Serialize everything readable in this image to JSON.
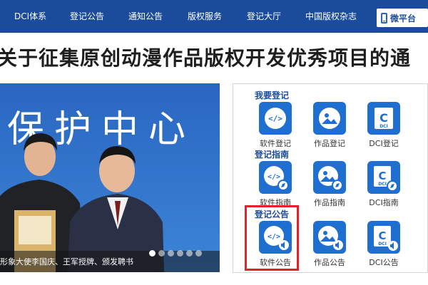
{
  "nav": {
    "items": [
      {
        "label": "DCI体系"
      },
      {
        "label": "登记公告"
      },
      {
        "label": "通知公告"
      },
      {
        "label": "版权服务"
      },
      {
        "label": "登记大厅"
      },
      {
        "label": "中国版权杂志"
      }
    ],
    "mobile_label": "微平台"
  },
  "headline": "关于征集原创动漫作品版权开发优秀项目的通",
  "slideshow": {
    "backdrop_text": "保护中心",
    "caption": "形象大使李国庆、王军授牌、颁发聘书",
    "dot_count": 6,
    "active_dot": 1
  },
  "panel": {
    "sections": [
      {
        "title": "我要登记",
        "tiles": [
          {
            "label": "软件登记",
            "icon": "code-icon"
          },
          {
            "label": "作品登记",
            "icon": "image-icon"
          },
          {
            "label": "DCI登记",
            "icon": "dci-icon"
          }
        ]
      },
      {
        "title": "登记指南",
        "tiles": [
          {
            "label": "软件指南",
            "icon": "code-compass-icon"
          },
          {
            "label": "作品指南",
            "icon": "image-compass-icon"
          },
          {
            "label": "DCI指南",
            "icon": "dci-compass-icon"
          }
        ]
      },
      {
        "title": "登记公告",
        "tiles": [
          {
            "label": "软件公告",
            "icon": "code-speaker-icon"
          },
          {
            "label": "作品公告",
            "icon": "image-speaker-icon"
          },
          {
            "label": "DCI公告",
            "icon": "dci-speaker-icon"
          }
        ]
      }
    ]
  },
  "colors": {
    "nav_bg": "#1b4c9b",
    "tile_blue": "#1f6fd0",
    "highlight_red": "#e2232a"
  }
}
